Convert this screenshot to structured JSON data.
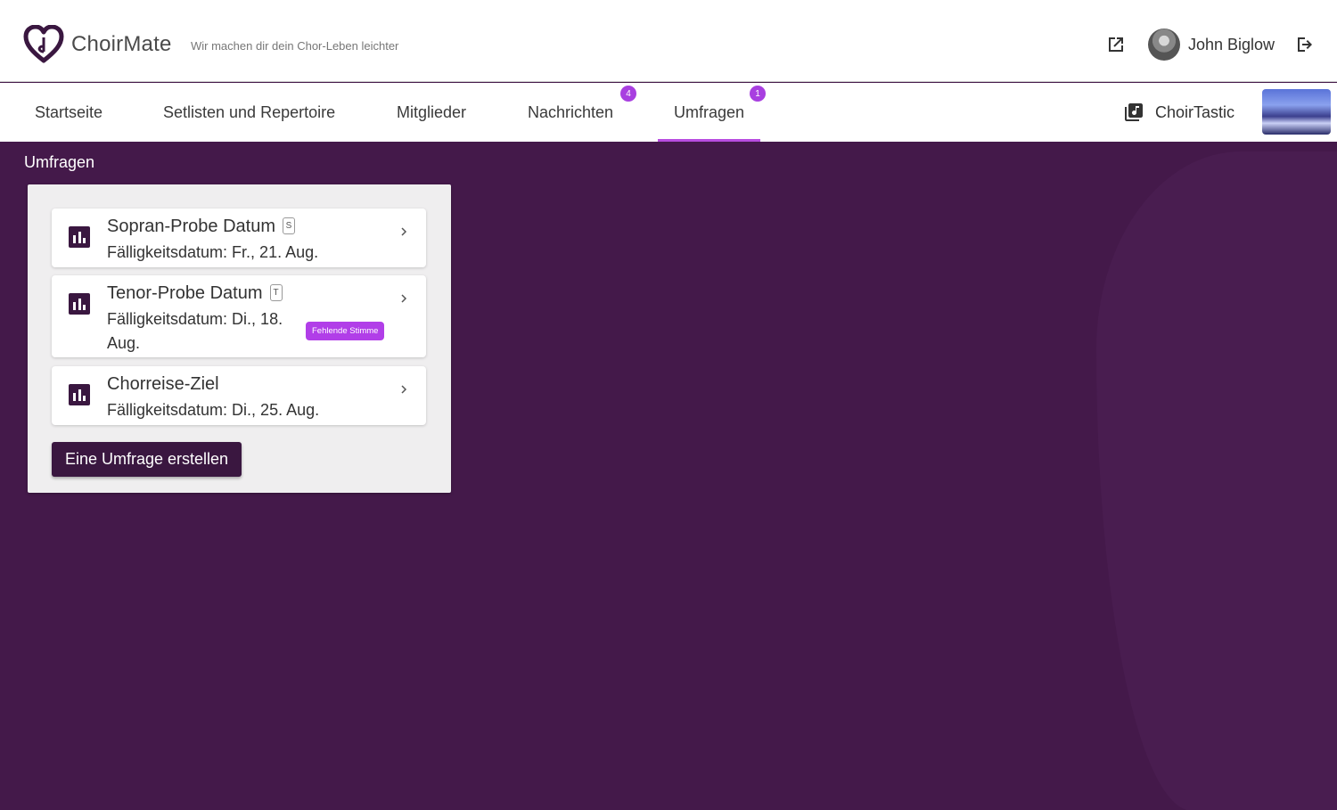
{
  "header": {
    "app_name": "ChoirMate",
    "tagline": "Wir machen dir dein Chor-Leben leichter",
    "user_name": "John Biglow",
    "icons": [
      "heart-logo-icon",
      "external-link-icon",
      "avatar",
      "logout-icon"
    ]
  },
  "nav": {
    "tabs": [
      {
        "label": "Startseite"
      },
      {
        "label": "Setlisten und Repertoire"
      },
      {
        "label": "Mitglieder"
      },
      {
        "label": "Nachrichten",
        "badge": "4"
      },
      {
        "label": "Umfragen",
        "badge": "1",
        "active": true
      }
    ],
    "choir_name": "ChoirTastic"
  },
  "main": {
    "section_title": "Umfragen",
    "polls": [
      {
        "title": "Sopran-Probe Datum",
        "voice": "S",
        "due": "Fälligkeitsdatum: Fr., 21. Aug."
      },
      {
        "title": "Tenor-Probe Datum",
        "voice": "T",
        "due": "Fälligkeitsdatum: Di., 18. Aug.",
        "status_badge": "Fehlende Stimme"
      },
      {
        "title": "Chorreise-Ziel",
        "due": "Fälligkeitsdatum: Di., 25. Aug."
      }
    ],
    "create_button": "Eine Umfrage erstellen"
  },
  "colors": {
    "brand_dark": "#3a1740",
    "background": "#44194a",
    "accent": "#b84de0",
    "badge": "#a83fe0"
  }
}
